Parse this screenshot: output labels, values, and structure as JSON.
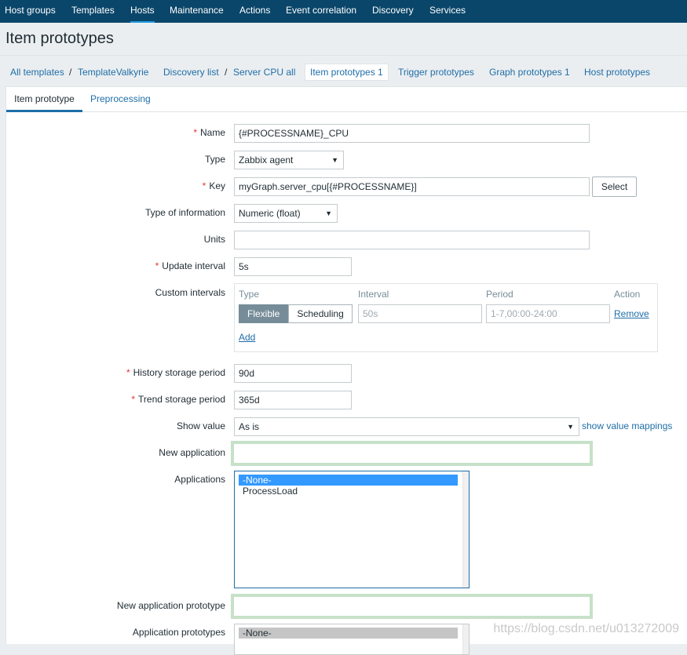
{
  "nav": {
    "items": [
      "Host groups",
      "Templates",
      "Hosts",
      "Maintenance",
      "Actions",
      "Event correlation",
      "Discovery",
      "Services"
    ],
    "active": "Hosts"
  },
  "page": {
    "title": "Item prototypes"
  },
  "breadcrumb": {
    "items": [
      "All templates",
      "TemplateValkyrie",
      "Discovery list",
      "Server CPU all",
      "Item prototypes 1",
      "Trigger prototypes",
      "Graph prototypes 1",
      "Host prototypes"
    ],
    "separator": "/"
  },
  "tabs": {
    "item_prototype": "Item prototype",
    "preprocessing": "Preprocessing"
  },
  "form": {
    "required_mark": "*",
    "name": {
      "label": "Name",
      "value": "{#PROCESSNAME}_CPU"
    },
    "type": {
      "label": "Type",
      "value": "Zabbix agent"
    },
    "key": {
      "label": "Key",
      "value": "myGraph.server_cpu[{#PROCESSNAME}]",
      "select_button": "Select"
    },
    "type_of_information": {
      "label": "Type of information",
      "value": "Numeric (float)"
    },
    "units": {
      "label": "Units",
      "value": ""
    },
    "update_interval": {
      "label": "Update interval",
      "value": "5s"
    },
    "custom_intervals": {
      "label": "Custom intervals",
      "columns": [
        "Type",
        "Interval",
        "Period",
        "Action"
      ],
      "type_options": [
        "Flexible",
        "Scheduling"
      ],
      "type_selected": "Flexible",
      "interval_placeholder": "50s",
      "period_placeholder": "1-7,00:00-24:00",
      "remove": "Remove",
      "add": "Add"
    },
    "history_storage_period": {
      "label": "History storage period",
      "value": "90d"
    },
    "trend_storage_period": {
      "label": "Trend storage period",
      "value": "365d"
    },
    "show_value": {
      "label": "Show value",
      "value": "As is",
      "mappings_link": "show value mappings"
    },
    "new_application": {
      "label": "New application",
      "value": ""
    },
    "applications": {
      "label": "Applications",
      "options": [
        "-None-",
        "ProcessLoad"
      ],
      "selected": "-None-"
    },
    "new_application_prototype": {
      "label": "New application prototype",
      "value": ""
    },
    "application_prototypes": {
      "label": "Application prototypes",
      "options": [
        "-None-"
      ],
      "selected": "-None-"
    }
  },
  "colors": {
    "nav_bg": "#0a466a",
    "link": "#1f6ea8",
    "required": "#e33734",
    "highlight": "#c7e1c8"
  },
  "watermark": "https://blog.csdn.net/u013272009"
}
